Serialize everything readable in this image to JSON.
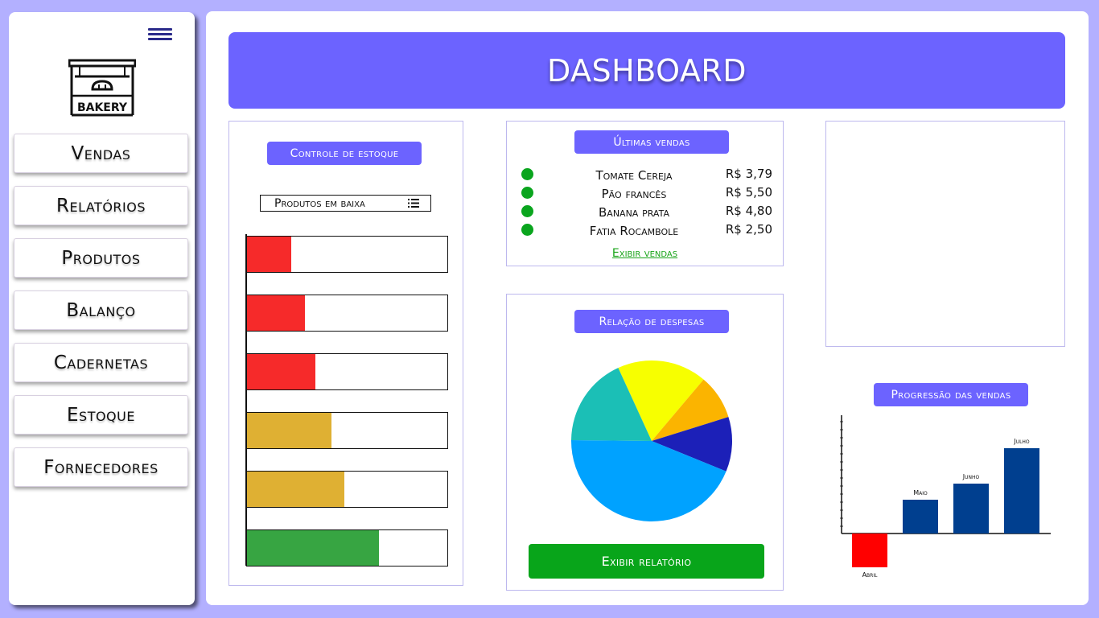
{
  "sidebar": {
    "logo_text": "BAKERY",
    "items": [
      {
        "label": "Vendas"
      },
      {
        "label": "Relatórios"
      },
      {
        "label": "Produtos"
      },
      {
        "label": "Balanço"
      },
      {
        "label": "Cadernetas"
      },
      {
        "label": "Estoque"
      },
      {
        "label": "Fornecedores"
      }
    ]
  },
  "header": {
    "title": "DASHBOARD"
  },
  "stock": {
    "title": "Controle de estoque",
    "dropdown_label": "Produtos em baixa",
    "levels": [
      {
        "fraction": 0.22,
        "color": "#f62a2a"
      },
      {
        "fraction": 0.29,
        "color": "#f62a2a"
      },
      {
        "fraction": 0.34,
        "color": "#f62a2a"
      },
      {
        "fraction": 0.42,
        "color": "#dfb033"
      },
      {
        "fraction": 0.485,
        "color": "#dfb033"
      },
      {
        "fraction": 0.66,
        "color": "#37a542"
      }
    ]
  },
  "sales": {
    "title": "Últimas vendas",
    "items": [
      {
        "name": "Tomate Cereja",
        "price": "R$ 3,79"
      },
      {
        "name": "Pão francês",
        "price": "R$ 5,50"
      },
      {
        "name": "Banana prata",
        "price": "R$ 4,80"
      },
      {
        "name": "Fatia Rocambole",
        "price": "R$ 2,50"
      }
    ],
    "link": "Exibir vendas"
  },
  "expenses": {
    "title": "Relação de despesas",
    "button": "Exibir relatório",
    "chart_data": {
      "type": "pie",
      "slices": [
        {
          "value": 18,
          "color": "#f7ff00"
        },
        {
          "value": 9,
          "color": "#fbb400"
        },
        {
          "value": 11,
          "color": "#1c20b8"
        },
        {
          "value": 44,
          "color": "#00a2ff"
        },
        {
          "value": 18,
          "color": "#1bbfb6"
        }
      ]
    }
  },
  "progress": {
    "title": "Progressão das vendas",
    "chart_data": {
      "type": "bar",
      "categories": [
        "Abril",
        "Maio",
        "Junho",
        "Julho"
      ],
      "values": [
        -42,
        42,
        62,
        106
      ],
      "colors": [
        "#ff0000",
        "#003f8f",
        "#003f8f",
        "#003f8f"
      ]
    }
  },
  "colors": {
    "accent": "#6c63ff",
    "background": "#b3b0ff",
    "success": "#08a51a"
  }
}
